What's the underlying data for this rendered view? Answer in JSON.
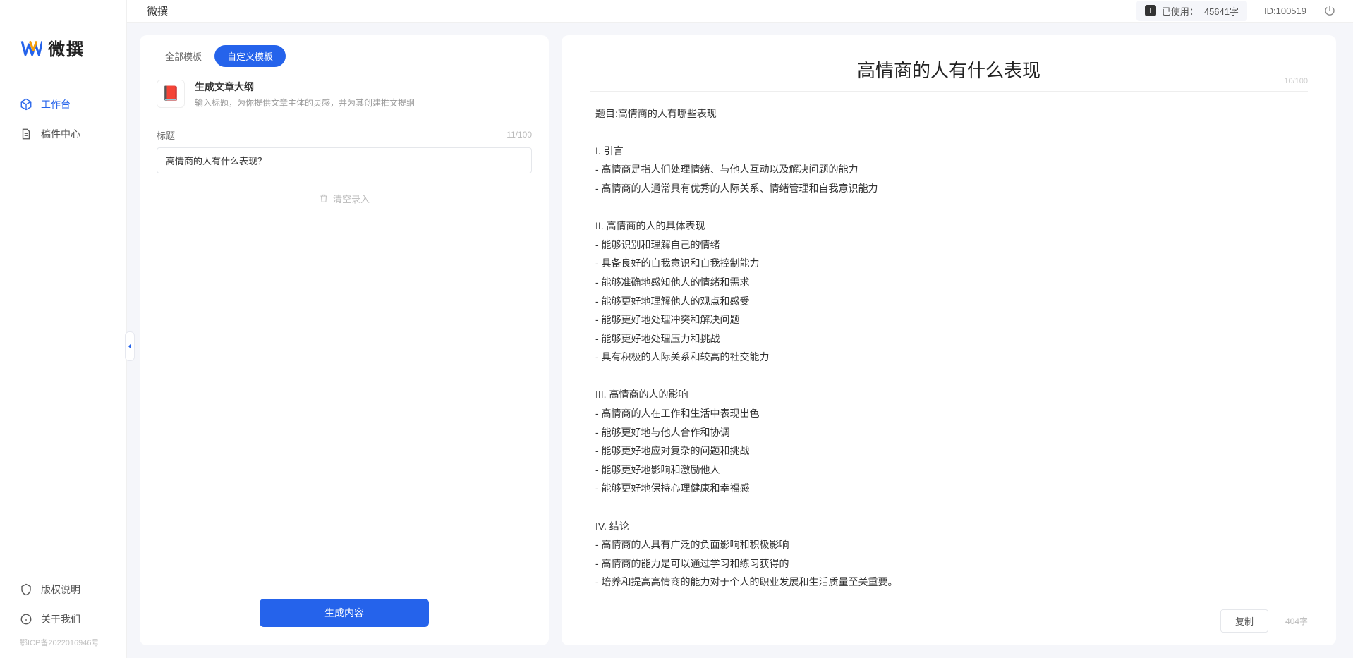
{
  "brand": {
    "name": "微撰"
  },
  "sidebar": {
    "items": [
      {
        "label": "工作台",
        "active": true
      },
      {
        "label": "稿件中心",
        "active": false
      }
    ],
    "bottom": [
      {
        "label": "版权说明"
      },
      {
        "label": "关于我们"
      }
    ],
    "license": "鄂ICP备2022016946号"
  },
  "topbar": {
    "title": "微撰",
    "usage_prefix": "已使用：",
    "usage_value": "45641字",
    "usage_tag": "T",
    "id_label": "ID:100519"
  },
  "left": {
    "tabs": [
      {
        "label": "全部模板",
        "active": false
      },
      {
        "label": "自定义模板",
        "active": true
      }
    ],
    "template": {
      "emoji": "📕",
      "title": "生成文章大纲",
      "desc": "输入标题，为你提供文章主体的灵感，并为其创建推文提纲"
    },
    "field_label": "标题",
    "field_count": "11/100",
    "field_value": "高情商的人有什么表现？",
    "clear_label": "清空录入",
    "generate_label": "生成内容"
  },
  "output": {
    "title": "高情商的人有什么表现",
    "title_count": "10/100",
    "body": "题目:高情商的人有哪些表现\n\nI. 引言\n- 高情商是指人们处理情绪、与他人互动以及解决问题的能力\n- 高情商的人通常具有优秀的人际关系、情绪管理和自我意识能力\n\nII. 高情商的人的具体表现\n- 能够识别和理解自己的情绪\n- 具备良好的自我意识和自我控制能力\n- 能够准确地感知他人的情绪和需求\n- 能够更好地理解他人的观点和感受\n- 能够更好地处理冲突和解决问题\n- 能够更好地处理压力和挑战\n- 具有积极的人际关系和较高的社交能力\n\nIII. 高情商的人的影响\n- 高情商的人在工作和生活中表现出色\n- 能够更好地与他人合作和协调\n- 能够更好地应对复杂的问题和挑战\n- 能够更好地影响和激励他人\n- 能够更好地保持心理健康和幸福感\n\nIV. 结论\n- 高情商的人具有广泛的负面影响和积极影响\n- 高情商的能力是可以通过学习和练习获得的\n- 培养和提高高情商的能力对于个人的职业发展和生活质量至关重要。",
    "copy_label": "复制",
    "word_count": "404字"
  }
}
